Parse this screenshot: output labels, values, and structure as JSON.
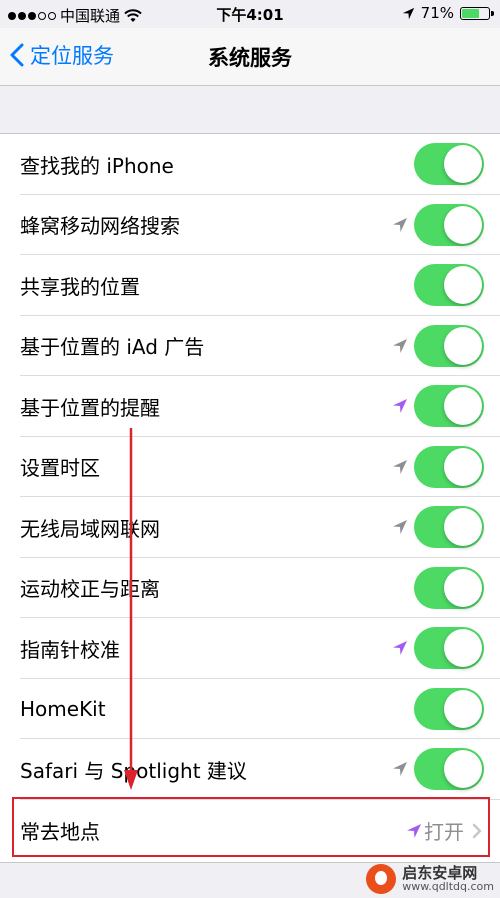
{
  "status_bar": {
    "carrier": "中国联通",
    "time": "下午4:01",
    "battery_percent": "71%",
    "battery_level": 0.71,
    "signal_dots_filled": 3,
    "signal_dots_total": 5,
    "icons": [
      "wifi-icon",
      "location-arrow-icon",
      "battery-icon"
    ]
  },
  "nav": {
    "back_label": "定位服务",
    "title": "系统服务"
  },
  "rows": [
    {
      "label": "查找我的 iPhone",
      "arrow": "none",
      "toggle": true
    },
    {
      "label": "蜂窝移动网络搜索",
      "arrow": "gray",
      "toggle": true
    },
    {
      "label": "共享我的位置",
      "arrow": "none",
      "toggle": true
    },
    {
      "label": "基于位置的 iAd 广告",
      "arrow": "gray",
      "toggle": true
    },
    {
      "label": "基于位置的提醒",
      "arrow": "purple",
      "toggle": true
    },
    {
      "label": "设置时区",
      "arrow": "gray",
      "toggle": true
    },
    {
      "label": "无线局域网联网",
      "arrow": "gray",
      "toggle": true
    },
    {
      "label": "运动校正与距离",
      "arrow": "none",
      "toggle": true
    },
    {
      "label": "指南针校准",
      "arrow": "purple",
      "toggle": true
    },
    {
      "label": "HomeKit",
      "arrow": "none",
      "toggle": true
    },
    {
      "label": "Safari 与 Spotlight 建议",
      "arrow": "gray",
      "toggle": true
    }
  ],
  "last_row": {
    "label": "常去地点",
    "value": "打开",
    "arrow": "purple"
  },
  "colors": {
    "toggle_on": "#4cd964",
    "ios_blue": "#007aff",
    "arrow_gray": "#8e8e93",
    "arrow_purple": "#a45bf2",
    "highlight_red": "#d9232d"
  },
  "watermark": {
    "name": "启东安卓网",
    "url": "www.qdltdq.com"
  }
}
